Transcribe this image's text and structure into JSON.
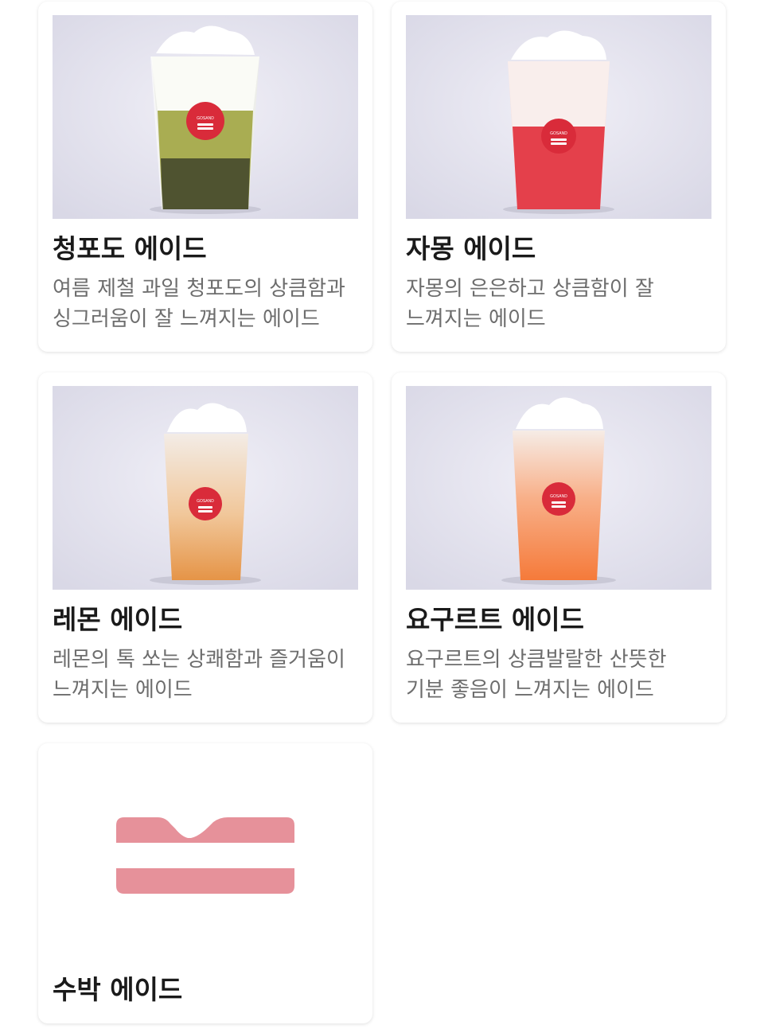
{
  "menu": {
    "items": [
      {
        "title": "청포도 에이드",
        "desc_line1": "여름 제철 과일 청포도의 상큼함과",
        "desc_line2": "싱그러움이 잘 느껴지는 에이드",
        "image": "green-grape-ade-photo",
        "drink_color": "#a9ad52"
      },
      {
        "title": "자몽 에이드",
        "desc_line1": "자몽의 은은하고 상큼함이 잘",
        "desc_line2": "느껴지는 에이드",
        "image": "grapefruit-ade-photo",
        "drink_color": "#e4404b"
      },
      {
        "title": "레몬 에이드",
        "desc_line1": "레몬의 톡 쏘는 상쾌함과 즐거움이",
        "desc_line2": "느껴지는 에이드",
        "image": "lemon-ade-photo",
        "drink_color": "#eca24a"
      },
      {
        "title": "요구르트 에이드",
        "desc_line1": "요구르트의 상큼발랄한 산뜻한",
        "desc_line2": "기분 좋음이 느껴지는 에이드",
        "image": "yogurt-ade-photo",
        "drink_color": "#f57a3a"
      },
      {
        "title": "수박 에이드",
        "image": "gosand-logo-placeholder"
      }
    ],
    "cup_badge_text": "GOSAND",
    "brand_color": "#d92b3a",
    "placeholder_logo_color": "#e6919a",
    "photo_background": "#e4e3ef"
  }
}
